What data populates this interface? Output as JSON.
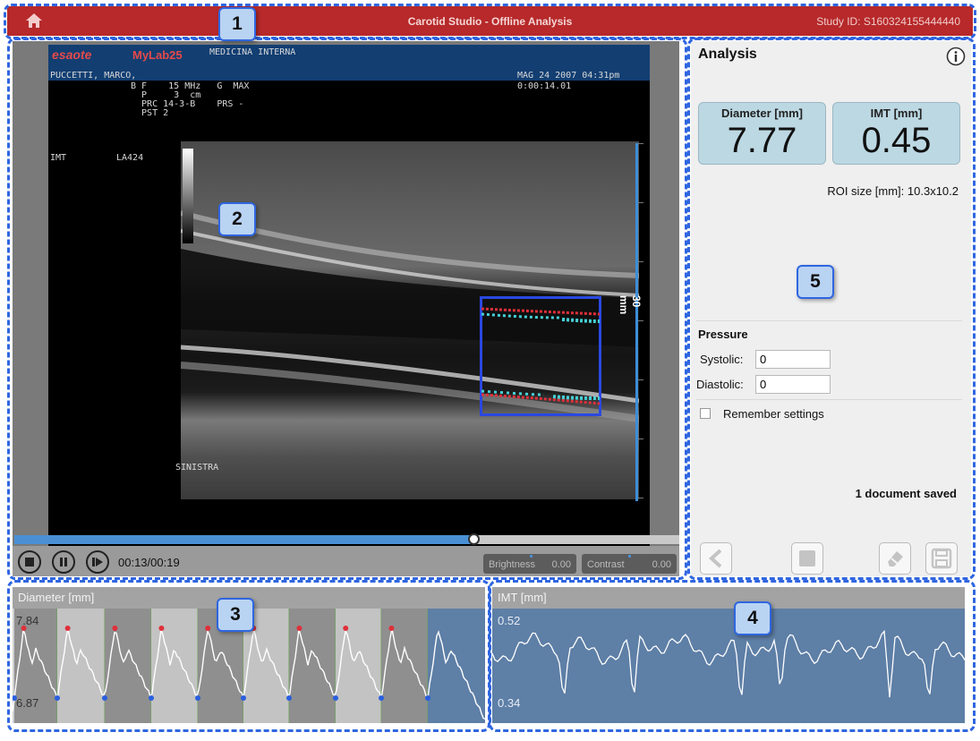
{
  "titlebar": {
    "title": "Carotid Studio - Offline Analysis",
    "study_id": "Study ID: S160324155444440"
  },
  "ultrasound": {
    "brand_esaote": "esaote",
    "brand_model": "MyLab25",
    "department": "MEDICINA INTERNA",
    "patient": "PUCCETTI, MARCO,",
    "date": "MAG 24 2007 04:31pm",
    "time_code": "0:00:14.01",
    "params_line1": "B F    15 MHz   G  MAX",
    "params_line2": "  P     3  cm",
    "params_line3": "  PRC 14-3-B    PRS -",
    "params_line4": "  PST 2",
    "mode": "IMT",
    "probe": "LA424",
    "side": "SINISTRA",
    "scale_label": "30 mm"
  },
  "player": {
    "progress": 0.69,
    "time": "00:13/00:19",
    "brightness_label": "Brightness",
    "brightness_value": "0.00",
    "contrast_label": "Contrast",
    "contrast_value": "0.00"
  },
  "analysis": {
    "title": "Analysis",
    "diameter_label": "Diameter [mm]",
    "diameter_value": "7.77",
    "imt_label": "IMT [mm]",
    "imt_value": "0.45",
    "roi_size": "ROI size [mm]: 10.3x10.2",
    "pressure_title": "Pressure",
    "systolic_label": "Systolic:",
    "systolic_value": "0",
    "diastolic_label": "Diastolic:",
    "diastolic_value": "0",
    "remember_label": "Remember settings",
    "saved_status": "1 document saved"
  },
  "diameter_trace": {
    "title": "Diameter [mm]",
    "max_label": "7.84",
    "min_label": "6.87"
  },
  "imt_trace": {
    "title": "IMT [mm]",
    "max_label": "0.52",
    "min_label": "0.34"
  },
  "badges": [
    "1",
    "2",
    "3",
    "4",
    "5"
  ],
  "colors": {
    "titlebar": "#b7292a",
    "accent_blue": "#2f66e0",
    "metric_box": "#bcd8e3",
    "imt_plot_bg": "#5e7fa6",
    "max_marker": "#e0303a",
    "min_marker": "#2a5fe0"
  }
}
